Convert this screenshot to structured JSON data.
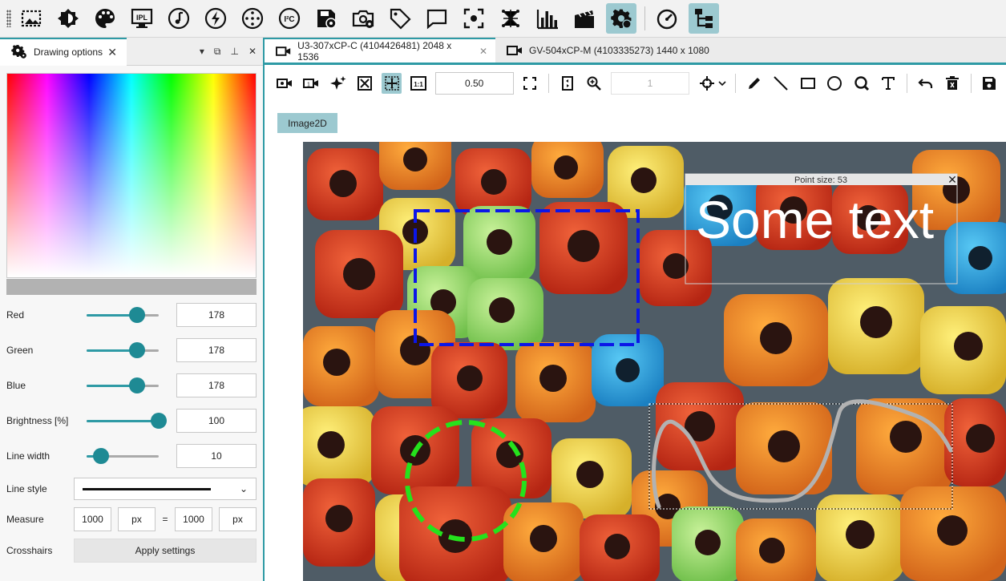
{
  "colors": {
    "accent": "#2e9aa5",
    "active_bg": "#9cc9d0",
    "swatch": "#b2b2b2"
  },
  "top_toolbar": {
    "icons": [
      "image-select-icon",
      "brightness-icon",
      "palette-icon",
      "ipl-icon",
      "music-note-icon",
      "flash-icon",
      "dial-icon",
      "i2c-icon",
      "save-settings-icon",
      "camera-settings-icon",
      "tag-icon",
      "comment-icon",
      "focus-icon",
      "network-icon",
      "histogram-icon",
      "clapperboard-icon",
      "gear-icon",
      "speedometer-icon",
      "tree-icon"
    ]
  },
  "panel": {
    "tab_label": "Drawing options",
    "rows": {
      "red": {
        "label": "Red",
        "value": "178",
        "level": 0.7
      },
      "green": {
        "label": "Green",
        "value": "178",
        "level": 0.7
      },
      "blue": {
        "label": "Blue",
        "value": "178",
        "level": 0.7
      },
      "brightness": {
        "label": "Brightness [%]",
        "value": "100",
        "level": 1.0
      },
      "line_width": {
        "label": "Line width",
        "value": "10",
        "level": 0.2
      }
    },
    "line_style_label": "Line style",
    "measure": {
      "label": "Measure",
      "v1": "1000",
      "u1": "px",
      "eq": "=",
      "v2": "1000",
      "u2": "px"
    },
    "crosshairs_label": "Crosshairs",
    "apply_label": "Apply settings"
  },
  "doc_tabs": [
    {
      "label": "U3-307xCP-C (4104426481) 2048 x 1536"
    },
    {
      "label": "GV-504xCP-M (4103335273) 1440 x 1080"
    }
  ],
  "viewer": {
    "zoom": "0.50",
    "frame": "1",
    "chip": "Image2D",
    "overlay_title": "Point size: 53",
    "overlay_text": "Some text"
  }
}
